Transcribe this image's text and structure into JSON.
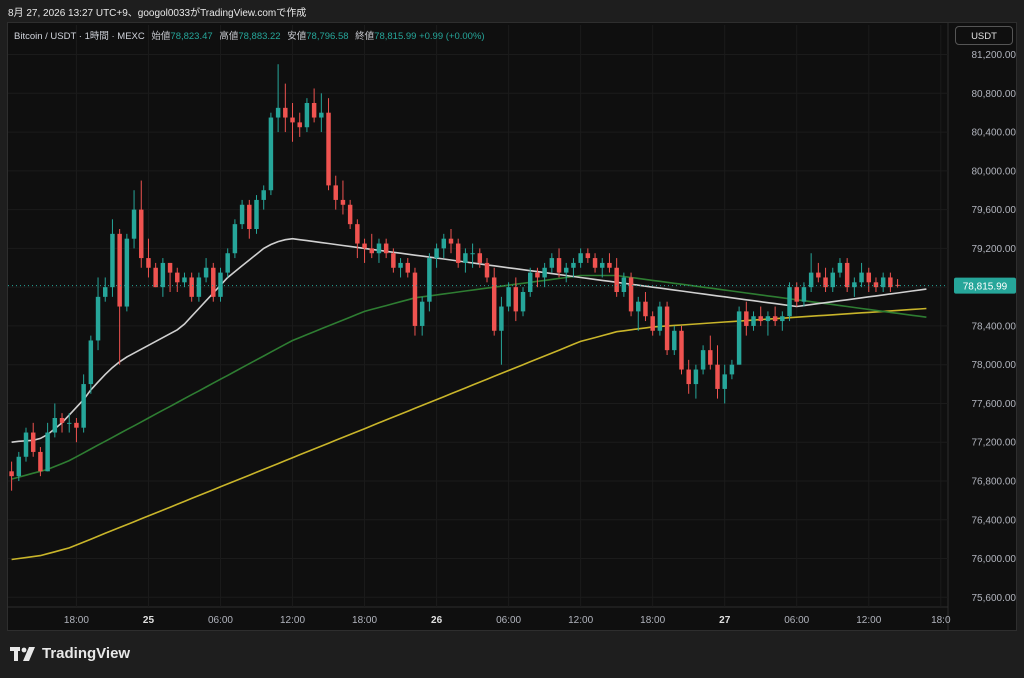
{
  "header": {
    "caption": "8月 27, 2026 13:27 UTC+9、googol0033がTradingView.comで作成"
  },
  "legend": {
    "symbol": "Bitcoin / USDT · 1時間 · MEXC",
    "open_label": "始値",
    "open": "78,823.47",
    "high_label": "高値",
    "high": "78,883.22",
    "low_label": "安値",
    "low": "78,796.58",
    "close_label": "終値",
    "close": "78,815.99",
    "change": "+0.99 (+0.00%)"
  },
  "currency_button": "USDT",
  "price_label": "78,815.99",
  "footer": {
    "brand": "TradingView"
  },
  "colors": {
    "up": "#26a69a",
    "down": "#ef5350",
    "ma_fast": "#d0d0d0",
    "ma_mid": "#2e7d32",
    "ma_slow": "#c9b52a"
  },
  "chart_data": {
    "type": "candlestick",
    "symbol": "BTC/USDT",
    "y_range": [
      75500,
      81350
    ],
    "y_ticks": [
      75600,
      76000,
      76400,
      76800,
      77200,
      77600,
      78000,
      78400,
      78800,
      79200,
      79600,
      80000,
      80400,
      80800,
      81200
    ],
    "y_tick_labels": [
      "75,600.00",
      "76,000.00",
      "76,400.00",
      "76,800.00",
      "77,200.00",
      "77,600.00",
      "78,000.00",
      "78,400.00",
      "78,800.00",
      "79,200.00",
      "79,600.00",
      "80,000.00",
      "80,400.00",
      "80,800.00",
      "81,200.00"
    ],
    "x_range": [
      -0.5,
      130
    ],
    "x_ticks": [
      {
        "label": "18:00",
        "i": 9
      },
      {
        "label": "25",
        "i": 19,
        "bold": true
      },
      {
        "label": "06:00",
        "i": 29
      },
      {
        "label": "12:00",
        "i": 39
      },
      {
        "label": "18:00",
        "i": 49
      },
      {
        "label": "26",
        "i": 59,
        "bold": true
      },
      {
        "label": "06:00",
        "i": 69
      },
      {
        "label": "12:00",
        "i": 79
      },
      {
        "label": "18:00",
        "i": 89
      },
      {
        "label": "27",
        "i": 99,
        "bold": true
      },
      {
        "label": "06:00",
        "i": 109
      },
      {
        "label": "12:00",
        "i": 119
      },
      {
        "label": "18:0",
        "i": 129
      }
    ],
    "last_price": 78815.99,
    "candles": [
      [
        76900,
        77000,
        76700,
        76850
      ],
      [
        76850,
        77100,
        76800,
        77050
      ],
      [
        77050,
        77350,
        77000,
        77300
      ],
      [
        77300,
        77400,
        77050,
        77100
      ],
      [
        77100,
        77150,
        76850,
        76900
      ],
      [
        76900,
        77400,
        76900,
        77300
      ],
      [
        77300,
        77600,
        77250,
        77450
      ],
      [
        77450,
        77500,
        77300,
        77400
      ],
      [
        77400,
        77500,
        77300,
        77400
      ],
      [
        77400,
        77450,
        77200,
        77350
      ],
      [
        77350,
        77900,
        77300,
        77800
      ],
      [
        77800,
        78300,
        77700,
        78250
      ],
      [
        78250,
        78900,
        78150,
        78700
      ],
      [
        78700,
        78900,
        78650,
        78800
      ],
      [
        78800,
        79500,
        78700,
        79350
      ],
      [
        79350,
        79400,
        78000,
        78600
      ],
      [
        78600,
        79350,
        78550,
        79300
      ],
      [
        79300,
        79800,
        79200,
        79600
      ],
      [
        79600,
        79900,
        79000,
        79100
      ],
      [
        79100,
        79300,
        78900,
        79000
      ],
      [
        79000,
        79050,
        78800,
        78800
      ],
      [
        78800,
        79100,
        78700,
        79050
      ],
      [
        79050,
        79050,
        78750,
        78950
      ],
      [
        78950,
        79000,
        78750,
        78850
      ],
      [
        78850,
        78950,
        78800,
        78900
      ],
      [
        78900,
        78950,
        78650,
        78700
      ],
      [
        78700,
        78950,
        78650,
        78900
      ],
      [
        78900,
        79100,
        78850,
        79000
      ],
      [
        79000,
        79050,
        78650,
        78700
      ],
      [
        78700,
        79000,
        78650,
        78950
      ],
      [
        78950,
        79200,
        78900,
        79150
      ],
      [
        79150,
        79500,
        79100,
        79450
      ],
      [
        79450,
        79700,
        79400,
        79650
      ],
      [
        79650,
        79700,
        79300,
        79400
      ],
      [
        79400,
        79750,
        79350,
        79700
      ],
      [
        79700,
        79850,
        79600,
        79800
      ],
      [
        79800,
        80600,
        79750,
        80550
      ],
      [
        80550,
        81100,
        80400,
        80650
      ],
      [
        80650,
        80900,
        80400,
        80550
      ],
      [
        80550,
        80700,
        80300,
        80500
      ],
      [
        80500,
        80600,
        80350,
        80450
      ],
      [
        80450,
        80750,
        80400,
        80700
      ],
      [
        80700,
        80850,
        80500,
        80550
      ],
      [
        80550,
        80800,
        80400,
        80600
      ],
      [
        80600,
        80750,
        79800,
        79850
      ],
      [
        79850,
        79950,
        79600,
        79700
      ],
      [
        79700,
        79900,
        79550,
        79650
      ],
      [
        79650,
        79700,
        79400,
        79450
      ],
      [
        79450,
        79500,
        79100,
        79250
      ],
      [
        79250,
        79300,
        79050,
        79200
      ],
      [
        79200,
        79350,
        79100,
        79150
      ],
      [
        79150,
        79300,
        79050,
        79250
      ],
      [
        79250,
        79300,
        79100,
        79150
      ],
      [
        79150,
        79200,
        78950,
        79000
      ],
      [
        79000,
        79100,
        78900,
        79050
      ],
      [
        79050,
        79100,
        78900,
        78950
      ],
      [
        78950,
        79000,
        78300,
        78400
      ],
      [
        78400,
        78700,
        78300,
        78650
      ],
      [
        78650,
        79150,
        78550,
        79100
      ],
      [
        79100,
        79250,
        79000,
        79200
      ],
      [
        79200,
        79350,
        79100,
        79300
      ],
      [
        79300,
        79400,
        79150,
        79250
      ],
      [
        79250,
        79300,
        79000,
        79050
      ],
      [
        79050,
        79200,
        78950,
        79150
      ],
      [
        79150,
        79250,
        79000,
        79150
      ],
      [
        79150,
        79200,
        79000,
        79050
      ],
      [
        79050,
        79100,
        78850,
        78900
      ],
      [
        78900,
        79000,
        78300,
        78350
      ],
      [
        78350,
        78700,
        78000,
        78600
      ],
      [
        78600,
        78850,
        78550,
        78800
      ],
      [
        78800,
        78900,
        78450,
        78550
      ],
      [
        78550,
        78800,
        78500,
        78750
      ],
      [
        78750,
        79000,
        78700,
        78950
      ],
      [
        78950,
        79000,
        78800,
        78900
      ],
      [
        78900,
        79050,
        78800,
        79000
      ],
      [
        79000,
        79150,
        78950,
        79100
      ],
      [
        79100,
        79200,
        78900,
        78950
      ],
      [
        78950,
        79050,
        78850,
        79000
      ],
      [
        79000,
        79100,
        78900,
        79050
      ],
      [
        79050,
        79200,
        79000,
        79150
      ],
      [
        79150,
        79200,
        79050,
        79100
      ],
      [
        79100,
        79150,
        78950,
        79000
      ],
      [
        79000,
        79100,
        78900,
        79050
      ],
      [
        79050,
        79150,
        78950,
        79000
      ],
      [
        79000,
        79100,
        78700,
        78750
      ],
      [
        78750,
        78950,
        78700,
        78900
      ],
      [
        78900,
        78950,
        78500,
        78550
      ],
      [
        78550,
        78700,
        78350,
        78650
      ],
      [
        78650,
        78750,
        78450,
        78500
      ],
      [
        78500,
        78550,
        78300,
        78350
      ],
      [
        78350,
        78650,
        78300,
        78600
      ],
      [
        78600,
        78650,
        78100,
        78150
      ],
      [
        78150,
        78400,
        78100,
        78350
      ],
      [
        78350,
        78400,
        77900,
        77950
      ],
      [
        77950,
        78050,
        77700,
        77800
      ],
      [
        77800,
        78000,
        77650,
        77950
      ],
      [
        77950,
        78200,
        77900,
        78150
      ],
      [
        78150,
        78300,
        77950,
        78000
      ],
      [
        78000,
        78200,
        77650,
        77750
      ],
      [
        77750,
        78000,
        77600,
        77900
      ],
      [
        77900,
        78050,
        77850,
        78000
      ],
      [
        78000,
        78600,
        78000,
        78550
      ],
      [
        78550,
        78650,
        78300,
        78400
      ],
      [
        78400,
        78550,
        78350,
        78500
      ],
      [
        78500,
        78600,
        78400,
        78450
      ],
      [
        78450,
        78550,
        78300,
        78500
      ],
      [
        78500,
        78600,
        78400,
        78450
      ],
      [
        78450,
        78550,
        78350,
        78500
      ],
      [
        78500,
        78850,
        78450,
        78800
      ],
      [
        78800,
        78850,
        78600,
        78650
      ],
      [
        78650,
        78850,
        78600,
        78800
      ],
      [
        78800,
        79150,
        78750,
        78950
      ],
      [
        78950,
        79050,
        78850,
        78900
      ],
      [
        78900,
        79000,
        78750,
        78800
      ],
      [
        78800,
        79000,
        78750,
        78950
      ],
      [
        78950,
        79100,
        78900,
        79050
      ],
      [
        79050,
        79100,
        78750,
        78800
      ],
      [
        78800,
        78900,
        78700,
        78850
      ],
      [
        78850,
        79050,
        78800,
        78950
      ],
      [
        78950,
        79000,
        78750,
        78850
      ],
      [
        78850,
        78900,
        78750,
        78800
      ],
      [
        78800,
        78950,
        78750,
        78900
      ],
      [
        78900,
        78950,
        78750,
        78800
      ],
      [
        78823.47,
        78883.22,
        78796.58,
        78815.99
      ]
    ],
    "ma_fast_values": [
      77200,
      77210,
      77215,
      77220,
      77240,
      77280,
      77340,
      77400,
      77480,
      77560,
      77640,
      77740,
      77820,
      77900,
      77970,
      78030,
      78080,
      78120,
      78160,
      78200,
      78240,
      78280,
      78320,
      78360,
      78420,
      78500,
      78580,
      78660,
      78740,
      78820,
      78900,
      78960,
      79020,
      79080,
      79140,
      79200,
      79240,
      79270,
      79290,
      79300,
      79290,
      79280,
      79270,
      79260,
      79250,
      79240,
      79230,
      79220,
      79210,
      79200,
      79190,
      79180,
      79170,
      79160,
      79150,
      79140,
      79130,
      79120,
      79110,
      79100,
      79090,
      79080,
      79070,
      79060,
      79050,
      79040,
      79030,
      79020,
      79010,
      79000,
      78990,
      78980,
      78970,
      78960,
      78950,
      78940,
      78930,
      78920,
      78910,
      78900,
      78890,
      78880,
      78870,
      78860,
      78850,
      78840,
      78830,
      78820,
      78810,
      78800,
      78790,
      78780,
      78770,
      78760,
      78750,
      78740,
      78730,
      78720,
      78710,
      78700,
      78690,
      78680,
      78670,
      78660,
      78650,
      78640,
      78630,
      78620,
      78610,
      78600,
      78610,
      78620,
      78630,
      78640,
      78650,
      78660,
      78670,
      78680,
      78690,
      78700,
      78710,
      78720,
      78730,
      78740,
      78750,
      78760,
      78770,
      78780
    ],
    "ma_mid_values": [
      76820,
      76840,
      76860,
      76880,
      76900,
      76920,
      76950,
      76980,
      77010,
      77050,
      77090,
      77130,
      77170,
      77210,
      77250,
      77290,
      77330,
      77370,
      77410,
      77450,
      77490,
      77530,
      77570,
      77610,
      77650,
      77690,
      77730,
      77770,
      77810,
      77850,
      77890,
      77930,
      77970,
      78010,
      78050,
      78090,
      78130,
      78170,
      78210,
      78250,
      78280,
      78310,
      78340,
      78370,
      78400,
      78430,
      78460,
      78490,
      78520,
      78550,
      78570,
      78590,
      78610,
      78630,
      78650,
      78670,
      78690,
      78700,
      78710,
      78720,
      78730,
      78740,
      78750,
      78760,
      78770,
      78780,
      78790,
      78800,
      78810,
      78820,
      78830,
      78840,
      78850,
      78860,
      78870,
      78880,
      78890,
      78900,
      78910,
      78920,
      78920,
      78920,
      78920,
      78920,
      78920,
      78910,
      78900,
      78890,
      78880,
      78870,
      78860,
      78850,
      78840,
      78830,
      78820,
      78810,
      78800,
      78790,
      78780,
      78770,
      78760,
      78750,
      78740,
      78730,
      78720,
      78710,
      78700,
      78690,
      78680,
      78670,
      78660,
      78650,
      78640,
      78630,
      78620,
      78610,
      78600,
      78590,
      78580,
      78570,
      78560,
      78550,
      78540,
      78530,
      78520,
      78510,
      78500,
      78490
    ],
    "ma_slow_values": [
      75990,
      76000,
      76010,
      76020,
      76030,
      76050,
      76070,
      76090,
      76110,
      76140,
      76170,
      76200,
      76230,
      76260,
      76290,
      76320,
      76350,
      76380,
      76410,
      76440,
      76470,
      76500,
      76530,
      76560,
      76590,
      76620,
      76650,
      76680,
      76710,
      76740,
      76770,
      76800,
      76830,
      76860,
      76890,
      76920,
      76950,
      76980,
      77010,
      77040,
      77070,
      77100,
      77130,
      77160,
      77190,
      77220,
      77250,
      77280,
      77310,
      77340,
      77370,
      77400,
      77430,
      77460,
      77490,
      77520,
      77550,
      77580,
      77610,
      77640,
      77670,
      77700,
      77730,
      77760,
      77790,
      77820,
      77850,
      77880,
      77910,
      77940,
      77970,
      78000,
      78030,
      78060,
      78090,
      78120,
      78150,
      78180,
      78210,
      78240,
      78260,
      78280,
      78300,
      78320,
      78340,
      78350,
      78360,
      78370,
      78380,
      78390,
      78395,
      78400,
      78405,
      78410,
      78415,
      78420,
      78425,
      78430,
      78435,
      78440,
      78445,
      78450,
      78455,
      78460,
      78465,
      78470,
      78475,
      78480,
      78485,
      78490,
      78495,
      78500,
      78505,
      78510,
      78515,
      78520,
      78525,
      78530,
      78535,
      78540,
      78545,
      78550,
      78555,
      78560,
      78565,
      78570,
      78575,
      78580
    ]
  }
}
